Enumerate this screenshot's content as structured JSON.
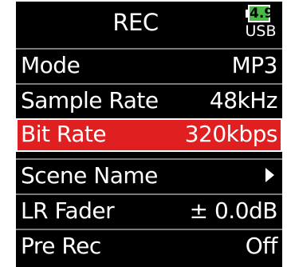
{
  "header": {
    "title": "REC",
    "battery_level": "4.9",
    "power_source": "USB",
    "battery_color": "#4cb848"
  },
  "menu": {
    "items": [
      {
        "label": "Mode",
        "value": "MP3",
        "selected": false
      },
      {
        "label": "Sample Rate",
        "value": "48kHz",
        "selected": false
      },
      {
        "label": "Bit Rate",
        "value": "320kbps",
        "selected": true
      },
      {
        "label": "Scene Name",
        "value": "",
        "icon": "chevron-right-icon",
        "selected": false
      },
      {
        "label": "LR Fader",
        "value": "± 0.0dB",
        "selected": false
      },
      {
        "label": "Pre Rec",
        "value": "Off",
        "selected": false
      }
    ]
  },
  "colors": {
    "background": "#000000",
    "selection": "#e02020",
    "divider": "#7a7a7a",
    "text": "#ffffff"
  }
}
